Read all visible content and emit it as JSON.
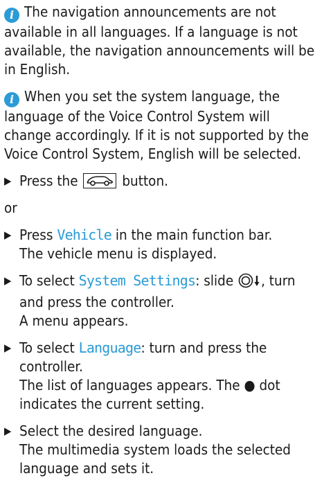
{
  "note1": {
    "text": "The navigation announcements are not available in all languages. If a language is not available, the navigation announcements will be in English."
  },
  "note2": {
    "text": "When you set the system language, the language of the Voice Control System will change accordingly. If it is not supported by the Voice Control System, English will be selected."
  },
  "step1": {
    "before": "Press the",
    "after": "button."
  },
  "or_text": "or",
  "step2": {
    "before": "Press",
    "keyword": "Vehicle",
    "after": "in the main function bar.",
    "result": "The vehicle menu is displayed."
  },
  "step3": {
    "before": "To select",
    "keyword": "System Settings",
    "middle": ": slide",
    "after": ", turn and press the controller.",
    "result": "A menu appears."
  },
  "step4": {
    "before": "To select",
    "keyword": "Language",
    "after": ": turn and press the controller.",
    "result": "The list of languages appears. The ● dot indicates the current setting."
  },
  "step5": {
    "text": "Select the desired language.",
    "result": "The multimedia system loads the selected language and sets it."
  },
  "icons": {
    "info": "info-icon",
    "step_marker": "triangle-right-icon",
    "vehicle_button": "car-icon",
    "controller_slide": "controller-slide-down-icon"
  },
  "colors": {
    "accent": "#2a9bd6",
    "text": "#1a1a1a"
  }
}
